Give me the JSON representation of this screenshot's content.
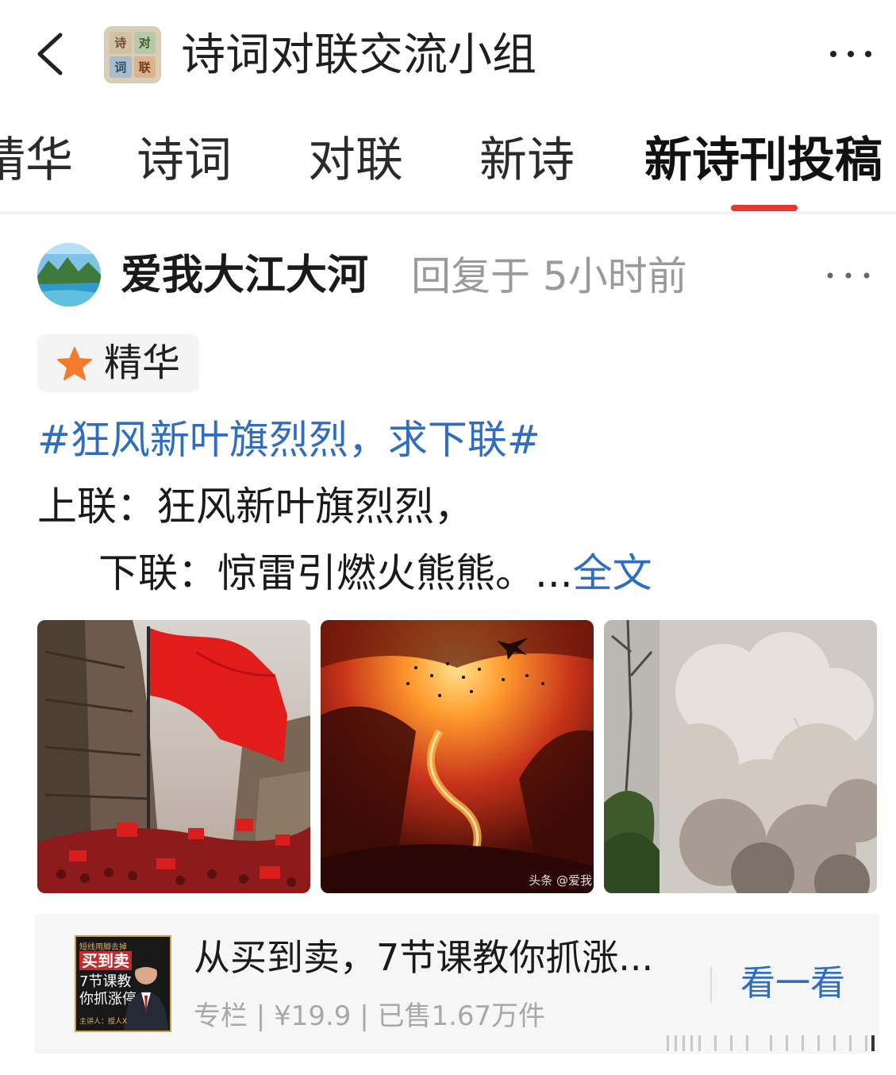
{
  "header": {
    "title": "诗词对联交流小组",
    "logo_chars": [
      "诗",
      "对",
      "词",
      "联"
    ]
  },
  "tabs": [
    {
      "label": "精华"
    },
    {
      "label": "诗词"
    },
    {
      "label": "对联"
    },
    {
      "label": "新诗"
    },
    {
      "label": "新诗刊投稿",
      "active": true
    }
  ],
  "post": {
    "author": "爱我大江大河",
    "reply_meta": "回复于 5小时前",
    "badge": "精华",
    "topic": "#狂风新叶旗烈烈，求下联#",
    "line1": "上联：狂风新叶旗烈烈，",
    "line2": "下联：惊雷引燃火熊熊。...",
    "full_text_link": "全文",
    "images": [
      {
        "icon": "red-flag-city-image"
      },
      {
        "icon": "fiery-battlefield-image",
        "watermark": "头条 @爱我"
      },
      {
        "icon": "smoke-cloud-image"
      }
    ]
  },
  "ad": {
    "title": "从买到卖，7节课教你抓涨...",
    "meta": "专栏 | ¥19.9 | 已售1.67万件",
    "cta": "看一看",
    "thumb": {
      "top_line": "短线用脚去掉",
      "title": "买到卖",
      "line2": "7节课教",
      "line3": "你抓涨停",
      "bottom": "主讲人：授人X"
    }
  },
  "colors": {
    "accent_red": "#e8372f",
    "link_blue": "#2f6dc1",
    "meta_gray": "#9a9a9a",
    "star_orange": "#f47a2c"
  }
}
